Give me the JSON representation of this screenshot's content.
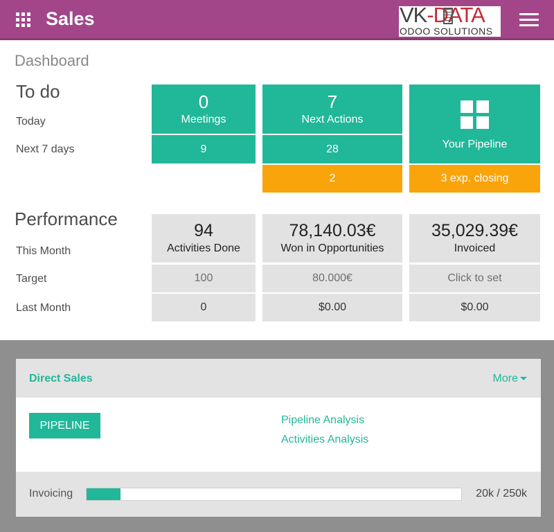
{
  "header": {
    "app_title": "Sales",
    "apps_icon": "apps-grid-icon",
    "menu_icon": "hamburger-menu-icon",
    "logo": {
      "line1_a": "VK",
      "line1_b": "-DATA",
      "line2": "ODOO SOLUTIONS"
    },
    "color": "#a24689"
  },
  "dashboard": {
    "title": "Dashboard",
    "todo": {
      "heading": "To do",
      "row_today": "Today",
      "row_next7": "Next 7 days",
      "meetings": {
        "today": "0",
        "label": "Meetings",
        "next7": "9"
      },
      "next_actions": {
        "today": "7",
        "label": "Next Actions",
        "next7": "28",
        "overdue": "2"
      },
      "pipeline": {
        "label": "Your Pipeline",
        "closing": "3 exp. closing",
        "icon": "grid-icon"
      }
    },
    "performance": {
      "heading": "Performance",
      "row_this_month": "This Month",
      "row_target": "Target",
      "row_last_month": "Last Month",
      "activities": {
        "value": "94",
        "label": "Activities Done",
        "target": "100",
        "last_month": "0"
      },
      "won": {
        "value": "78,140.03€",
        "label": "Won in Opportunities",
        "target": "80.000€",
        "last_month": "$0.00"
      },
      "invoiced": {
        "value": "35,029.39€",
        "label": "Invoiced",
        "target": "Click to set",
        "last_month": "$0.00"
      }
    }
  },
  "team": {
    "name": "Direct Sales",
    "more": "More",
    "pipeline_button": "PIPELINE",
    "links": [
      "Pipeline Analysis",
      "Activities Analysis"
    ],
    "invoicing": {
      "label": "Invoicing",
      "value": "20k / 250k",
      "progress": 0.09
    }
  },
  "colors": {
    "green": "#21b799",
    "orange": "#f9a40a",
    "grey": "#e2e2e2"
  }
}
